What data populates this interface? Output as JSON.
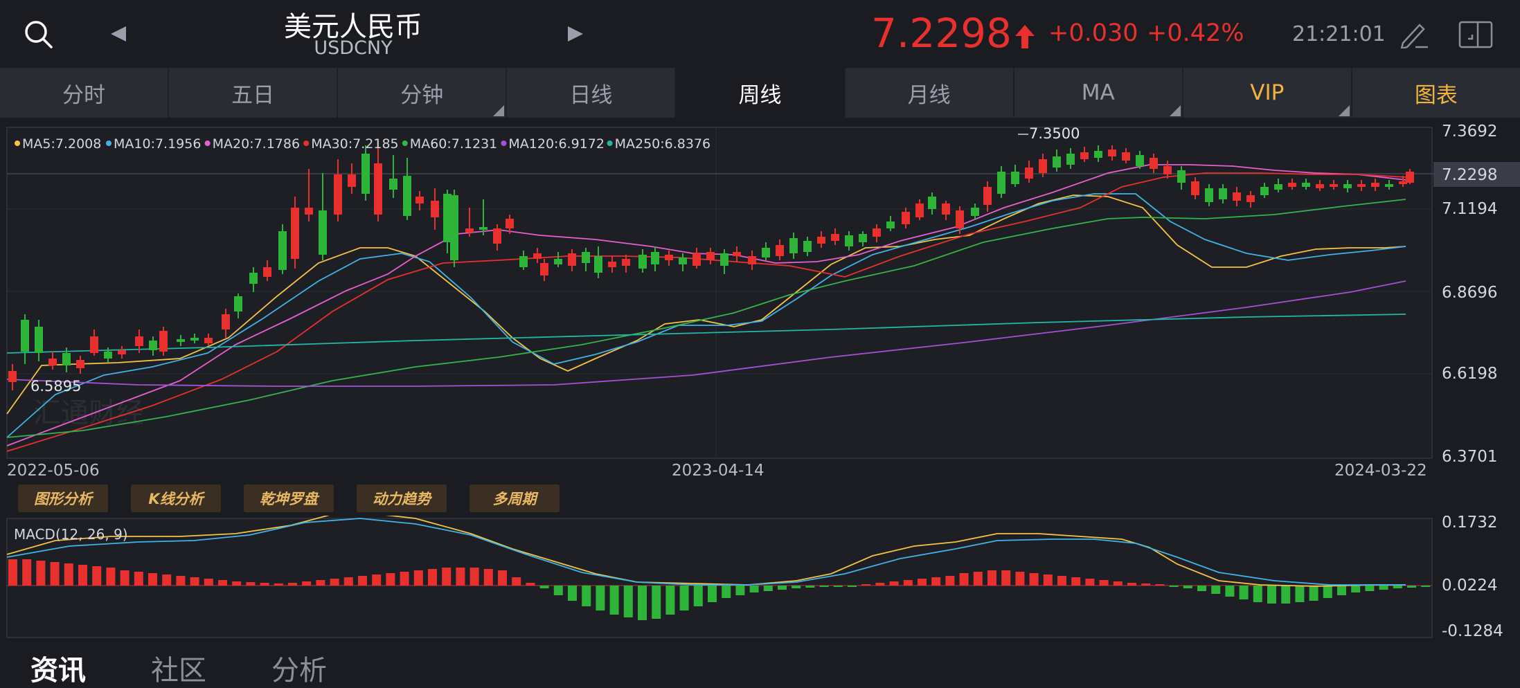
{
  "header": {
    "title": "美元人民币",
    "symbol": "USDCNY",
    "price": "7.2298",
    "change": "+0.030",
    "change_pct": "+0.42%",
    "time": "21:21:01",
    "up_color": "#e8312f"
  },
  "tabs": [
    {
      "label": "分时"
    },
    {
      "label": "五日"
    },
    {
      "label": "分钟"
    },
    {
      "label": "日线"
    },
    {
      "label": "周线"
    },
    {
      "label": "月线"
    },
    {
      "label": "MA"
    },
    {
      "label": "VIP"
    },
    {
      "label": "图表"
    }
  ],
  "chart": {
    "legend": [
      {
        "text": "MA5:7.2008",
        "color": "#f5c442"
      },
      {
        "text": "MA10:7.1956",
        "color": "#3fb4e8"
      },
      {
        "text": "MA20:7.1786",
        "color": "#e85fd0"
      },
      {
        "text": "MA30:7.2185",
        "color": "#e8312f"
      },
      {
        "text": "MA60:7.1231",
        "color": "#32b54a"
      },
      {
        "text": "MA120:6.9172",
        "color": "#a650d8"
      },
      {
        "text": "MA250:6.8376",
        "color": "#22b8a8"
      }
    ],
    "y_ticks": [
      "7.3692",
      "7.2298",
      "7.1194",
      "6.8696",
      "6.6198",
      "6.3701"
    ],
    "x_ticks": [
      "2022-05-06",
      "2023-04-14",
      "2024-03-22"
    ],
    "high_label": "7.3500",
    "low_label": "6.5895",
    "watermark": "汇通财经"
  },
  "tools": [
    "图形分析",
    "K线分析",
    "乾坤罗盘",
    "动力趋势",
    "多周期"
  ],
  "macd": {
    "title": "MACD(12, 26, 9)",
    "y_ticks": [
      "0.1732",
      "0.0224",
      "-0.1284"
    ]
  },
  "bottom_tabs": [
    "资讯",
    "社区",
    "分析"
  ]
}
